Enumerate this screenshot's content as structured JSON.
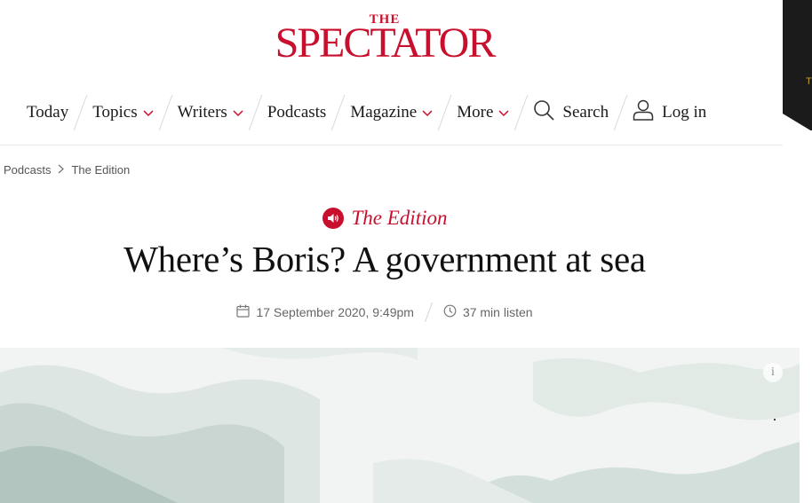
{
  "brand": {
    "logo_small": "THE",
    "logo_main": "SPECTATOR"
  },
  "corner": {
    "letter": "T"
  },
  "nav": {
    "today": "Today",
    "topics": "Topics",
    "writers": "Writers",
    "podcasts": "Podcasts",
    "magazine": "Magazine",
    "more": "More",
    "search": "Search",
    "login": "Log in"
  },
  "breadcrumb": {
    "parent": "Podcasts",
    "current": "The Edition"
  },
  "article": {
    "kicker": "The Edition",
    "title": "Where’s Boris? A government at sea",
    "date": "17 September 2020, 9:49pm",
    "duration": "37 min listen"
  },
  "hero": {
    "info_label": "i"
  },
  "colors": {
    "brand_red": "#c8102e",
    "dark": "#1b1b1b",
    "accent_gold": "#c9a227"
  },
  "icons": [
    "chevron-down-icon",
    "search-icon",
    "user-icon",
    "speaker-icon",
    "calendar-icon",
    "clock-icon",
    "info-icon"
  ]
}
